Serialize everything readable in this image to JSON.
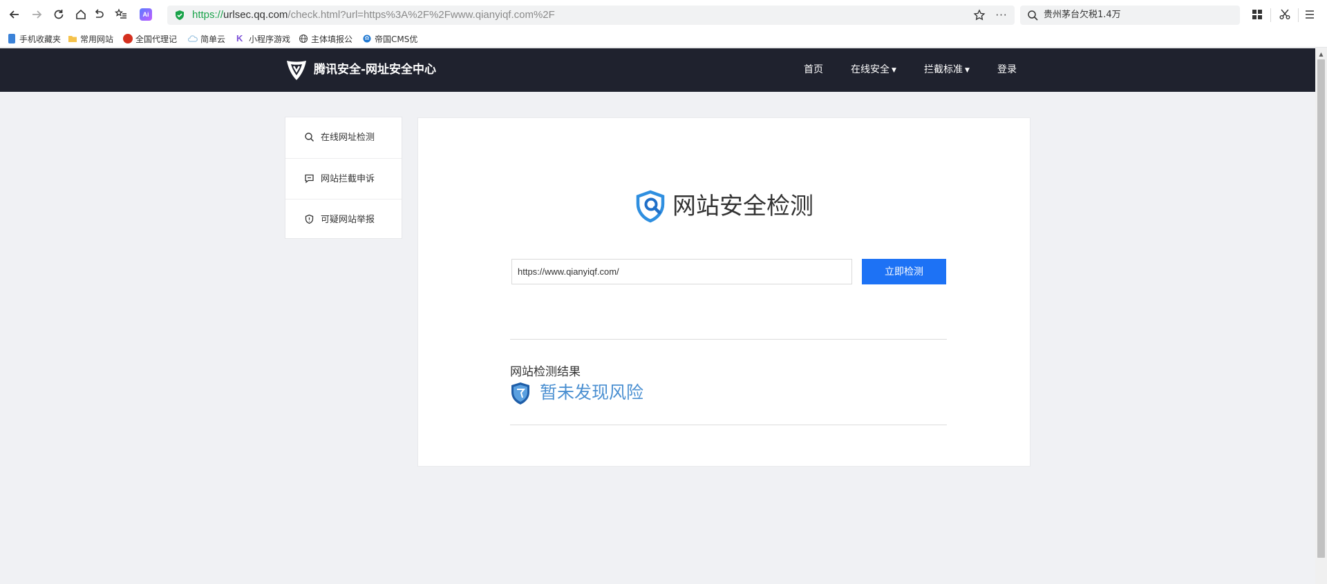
{
  "browser": {
    "url": {
      "scheme": "https://",
      "host": "urlsec.qq.com",
      "rest": "/check.html?url=https%3A%2F%2Fwww.qianyiqf.com%2F"
    },
    "search_text": "贵州茅台欠税1.4万",
    "ai_badge": "Ai",
    "more_glyph": "···",
    "bookmarks": [
      {
        "label": "手机收藏夹",
        "icon": "phone-icon"
      },
      {
        "label": "常用网站",
        "icon": "folder-icon"
      },
      {
        "label": "全国代理记",
        "icon": "emblem-icon"
      },
      {
        "label": "简单云",
        "icon": "cloud-icon"
      },
      {
        "label": "小程序游戏",
        "icon": "k-logo-icon"
      },
      {
        "label": "主体填报公",
        "icon": "globe-icon"
      },
      {
        "label": "帝国CMS优",
        "icon": "ie-icon"
      }
    ]
  },
  "site": {
    "logo_text": "腾讯安全-网址安全中心",
    "nav": [
      {
        "label": "首页"
      },
      {
        "label": "在线安全"
      },
      {
        "label": "拦截标准"
      },
      {
        "label": "登录"
      }
    ],
    "caret_glyph": "▼"
  },
  "sidebar": {
    "items": [
      {
        "label": "在线网址检测",
        "icon": "search-icon"
      },
      {
        "label": "网站拦截申诉",
        "icon": "chat-icon"
      },
      {
        "label": "可疑网站举报",
        "icon": "shield-icon"
      }
    ]
  },
  "main": {
    "title": "网站安全检测",
    "input_value": "https://www.qianyiqf.com/",
    "button_label": "立即检测",
    "result_label": "网站检测结果",
    "result_status": "暂未发现风险"
  },
  "colors": {
    "header_bg": "#1f222e",
    "primary_button": "#1d72f5",
    "result_text": "#4a8fd1",
    "page_bg": "#f0f1f4"
  }
}
